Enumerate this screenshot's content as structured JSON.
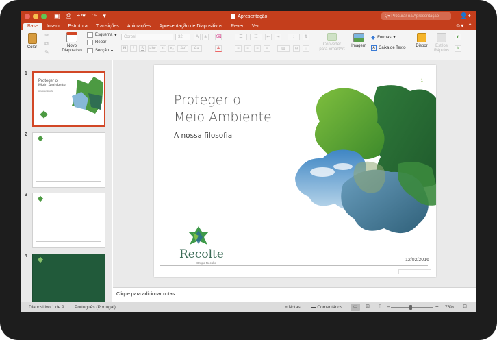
{
  "window": {
    "title": "Apresentação",
    "search_placeholder": "Procurar na Apresentação",
    "traffic_lights": [
      "#ed6a5e",
      "#f5bf4f",
      "#61c554"
    ]
  },
  "ribbon_tabs": [
    {
      "label": "Base",
      "active": true
    },
    {
      "label": "Inserir"
    },
    {
      "label": "Estrutura"
    },
    {
      "label": "Transições"
    },
    {
      "label": "Animações"
    },
    {
      "label": "Apresentação de Diapositivos"
    },
    {
      "label": "Rever"
    },
    {
      "label": "Ver"
    }
  ],
  "ribbon": {
    "paste": "Colar",
    "new_slide": "Novo\nDiapositivo",
    "layout": "Esquema",
    "reset": "Repor",
    "section": "Secção",
    "font_name": "Corbel",
    "font_size": "32",
    "convert": "Converter\npara SmartArt",
    "image": "Imagem",
    "shapes": "Formas",
    "textbox": "Caixa de Texto",
    "arrange": "Dispor",
    "quick_styles": "Estilos\nRápidos"
  },
  "thumbnails": [
    {
      "number": "1",
      "title": "Proteger o\nMeio Ambiente",
      "subtitle": "A nossa filosofia"
    },
    {
      "number": "2"
    },
    {
      "number": "3"
    },
    {
      "number": "4"
    }
  ],
  "slide": {
    "title": "Proteger o\nMeio Ambiente",
    "subtitle": "A nossa filosofia",
    "number": "1",
    "brand": "Recolte",
    "brand_sub": "Grupo Recolte",
    "date": "12/02/2016"
  },
  "notes_placeholder": "Clique para adicionar notas",
  "status": {
    "slide_info": "Diapositivo 1 de 9",
    "language": "Português (Portugal)",
    "notes": "Notas",
    "comments": "Comentários",
    "zoom": "76%"
  },
  "colors": {
    "accent": "#c43e1c",
    "selection": "#d24726",
    "green_slide": "#215a3a"
  }
}
